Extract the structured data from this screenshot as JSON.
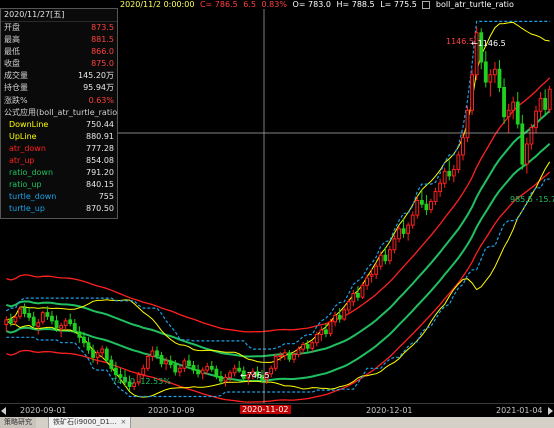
{
  "header": {
    "date": "2020/11/2 0:00:00",
    "close": "C= 786.5",
    "change": "6.5",
    "pct": "0.83%",
    "open": "O= 783.0",
    "high": "H= 788.5",
    "low": "L= 775.5",
    "indicator_name": "boll_atr_turtle_ratio"
  },
  "info_panel": {
    "date": "2020/11/27[五]",
    "rows": [
      {
        "label": "开盘",
        "value": "873.5",
        "color": "#ff4040"
      },
      {
        "label": "最高",
        "value": "881.5",
        "color": "#ff4040"
      },
      {
        "label": "最低",
        "value": "866.0",
        "color": "#ff4040"
      },
      {
        "label": "收盘",
        "value": "875.0",
        "color": "#ff4040"
      },
      {
        "label": "成交量",
        "value": "145.20万",
        "color": "#e8e8e8"
      },
      {
        "label": "持仓量",
        "value": "95.94万",
        "color": "#e8e8e8"
      },
      {
        "label": "涨跌%",
        "value": "0.63%",
        "color": "#ff4040"
      }
    ],
    "formula_title": "公式应用(boll_atr_turtle_ratio",
    "indicators": [
      {
        "label": "DownLine",
        "value": "750.44",
        "color": "#ffff00"
      },
      {
        "label": "UpLine",
        "value": "880.91",
        "color": "#ffff00"
      },
      {
        "label": "atr_down",
        "value": "777.28",
        "color": "#ff2020"
      },
      {
        "label": "atr_up",
        "value": "854.08",
        "color": "#ff2020"
      },
      {
        "label": "ratio_down",
        "value": "791.20",
        "color": "#20c060"
      },
      {
        "label": "ratio_up",
        "value": "840.15",
        "color": "#20c060"
      },
      {
        "label": "turtle_down",
        "value": "755",
        "color": "#1ea0e6"
      },
      {
        "label": "turtle_up",
        "value": "870.50",
        "color": "#1ea0e6"
      }
    ]
  },
  "chart_annotations": {
    "high_label": "1146.5",
    "high_marker": "←1146.5",
    "low_label": "747.0 -12.53%",
    "low_marker": "←746.5",
    "dip_label": "985.5 -15.79%"
  },
  "x_axis": [
    "2020-09-01",
    "2020-10-09",
    "2020-11-02",
    "2020-12-01",
    "2021-01-04"
  ],
  "tabs": [
    {
      "label": "策略研究"
    },
    {
      "label": "铁矿石(i9000_D1...",
      "close": "×"
    }
  ],
  "colors": {
    "up": "#ff2020",
    "down": "#20d020",
    "crosshair": "#b0b0b0",
    "boll": "#ffff00",
    "atr": "#ff2020",
    "ratio": "#20c060",
    "turtle": "#1ea0e6"
  },
  "chart_data": {
    "type": "candlestick",
    "ylim": [
      735,
      1165
    ],
    "candles": [
      [
        820,
        829,
        812,
        825
      ],
      [
        826,
        832,
        818,
        822
      ],
      [
        823,
        830,
        819,
        828
      ],
      [
        829,
        840,
        826,
        837
      ],
      [
        838,
        843,
        828,
        832
      ],
      [
        832,
        838,
        824,
        828
      ],
      [
        828,
        834,
        815,
        819
      ],
      [
        818,
        826,
        809,
        822
      ],
      [
        823,
        835,
        820,
        833
      ],
      [
        833,
        840,
        825,
        829
      ],
      [
        829,
        835,
        820,
        824
      ],
      [
        824,
        830,
        812,
        816
      ],
      [
        816,
        822,
        806,
        819
      ],
      [
        819,
        827,
        814,
        824
      ],
      [
        825,
        832,
        818,
        821
      ],
      [
        821,
        826,
        810,
        813
      ],
      [
        812,
        818,
        800,
        806
      ],
      [
        806,
        812,
        795,
        800
      ],
      [
        800,
        806,
        788,
        792
      ],
      [
        792,
        798,
        778,
        784
      ],
      [
        784,
        792,
        776,
        789
      ],
      [
        789,
        797,
        783,
        793
      ],
      [
        793,
        796,
        778,
        781
      ],
      [
        781,
        786,
        768,
        772
      ],
      [
        772,
        779,
        760,
        765
      ],
      [
        765,
        772,
        755,
        762
      ],
      [
        762,
        770,
        752,
        757
      ],
      [
        757,
        764,
        747,
        752
      ],
      [
        752,
        760,
        748,
        756
      ],
      [
        756,
        768,
        753,
        765
      ],
      [
        765,
        776,
        760,
        772
      ],
      [
        772,
        788,
        769,
        785
      ],
      [
        785,
        796,
        780,
        791
      ],
      [
        791,
        796,
        782,
        786
      ],
      [
        786,
        790,
        773,
        777
      ],
      [
        777,
        784,
        770,
        780
      ],
      [
        780,
        786,
        772,
        776
      ],
      [
        776,
        781,
        764,
        768
      ],
      [
        768,
        776,
        763,
        772
      ],
      [
        772,
        783,
        768,
        780
      ],
      [
        780,
        787,
        772,
        775
      ],
      [
        775,
        780,
        766,
        770
      ],
      [
        770,
        776,
        762,
        766
      ],
      [
        766,
        773,
        760,
        770
      ],
      [
        770,
        778,
        765,
        774
      ],
      [
        774,
        780,
        768,
        771
      ],
      [
        771,
        775,
        760,
        763
      ],
      [
        763,
        769,
        754,
        758
      ],
      [
        758,
        766,
        752,
        762
      ],
      [
        762,
        770,
        757,
        767
      ],
      [
        767,
        776,
        763,
        772
      ],
      [
        772,
        780,
        767,
        769
      ],
      [
        769,
        774,
        758,
        761
      ],
      [
        761,
        768,
        754,
        765
      ],
      [
        765,
        772,
        760,
        768
      ],
      [
        768,
        774,
        760,
        764
      ],
      [
        764,
        770,
        756,
        760
      ],
      [
        760,
        768,
        755,
        766
      ],
      [
        766,
        775,
        762,
        772
      ],
      [
        772,
        788,
        769,
        785
      ],
      [
        785,
        790,
        780,
        786
      ],
      [
        786,
        793,
        781,
        789
      ],
      [
        789,
        792,
        779,
        782
      ],
      [
        782,
        790,
        778,
        787
      ],
      [
        787,
        796,
        784,
        793
      ],
      [
        793,
        801,
        788,
        798
      ],
      [
        798,
        803,
        790,
        794
      ],
      [
        794,
        802,
        790,
        800
      ],
      [
        800,
        812,
        796,
        809
      ],
      [
        809,
        818,
        802,
        814
      ],
      [
        814,
        821,
        806,
        810
      ],
      [
        810,
        826,
        807,
        823
      ],
      [
        823,
        834,
        818,
        830
      ],
      [
        830,
        838,
        822,
        826
      ],
      [
        826,
        839,
        824,
        836
      ],
      [
        836,
        848,
        832,
        845
      ],
      [
        845,
        858,
        840,
        854
      ],
      [
        854,
        862,
        846,
        850
      ],
      [
        850,
        866,
        848,
        863
      ],
      [
        863,
        875,
        858,
        871
      ],
      [
        873,
        881,
        866,
        875
      ],
      [
        875,
        888,
        870,
        884
      ],
      [
        884,
        900,
        880,
        896
      ],
      [
        896,
        905,
        886,
        890
      ],
      [
        890,
        906,
        886,
        902
      ],
      [
        902,
        918,
        898,
        914
      ],
      [
        914,
        928,
        910,
        925
      ],
      [
        925,
        936,
        915,
        920
      ],
      [
        920,
        932,
        912,
        929
      ],
      [
        929,
        944,
        925,
        940
      ],
      [
        940,
        960,
        936,
        956
      ],
      [
        956,
        968,
        948,
        952
      ],
      [
        952,
        962,
        940,
        946
      ],
      [
        946,
        958,
        942,
        955
      ],
      [
        955,
        970,
        951,
        966
      ],
      [
        966,
        980,
        960,
        975
      ],
      [
        975,
        992,
        970,
        988
      ],
      [
        988,
        1000,
        978,
        983
      ],
      [
        983,
        995,
        976,
        990
      ],
      [
        990,
        1010,
        986,
        1006
      ],
      [
        1006,
        1030,
        1000,
        1025
      ],
      [
        1025,
        1060,
        1020,
        1055
      ],
      [
        1055,
        1100,
        1050,
        1094
      ],
      [
        1094,
        1146.5,
        1088,
        1140
      ],
      [
        1140,
        1145,
        1100,
        1108
      ],
      [
        1108,
        1120,
        1080,
        1086
      ],
      [
        1086,
        1100,
        1070,
        1094
      ],
      [
        1094,
        1108,
        1085,
        1100
      ],
      [
        1100,
        1110,
        1075,
        1080
      ],
      [
        1080,
        1090,
        1040,
        1048
      ],
      [
        1048,
        1062,
        1030,
        1055
      ],
      [
        1055,
        1070,
        1045,
        1064
      ],
      [
        1064,
        1075,
        1035,
        1040
      ],
      [
        1040,
        1050,
        990,
        996
      ],
      [
        996,
        1025,
        985.5,
        1018
      ],
      [
        1018,
        1040,
        1012,
        1036
      ],
      [
        1036,
        1060,
        1030,
        1054
      ],
      [
        1054,
        1075,
        1046,
        1068
      ],
      [
        1068,
        1078,
        1050,
        1056
      ],
      [
        1056,
        1082,
        1052,
        1078
      ]
    ]
  }
}
